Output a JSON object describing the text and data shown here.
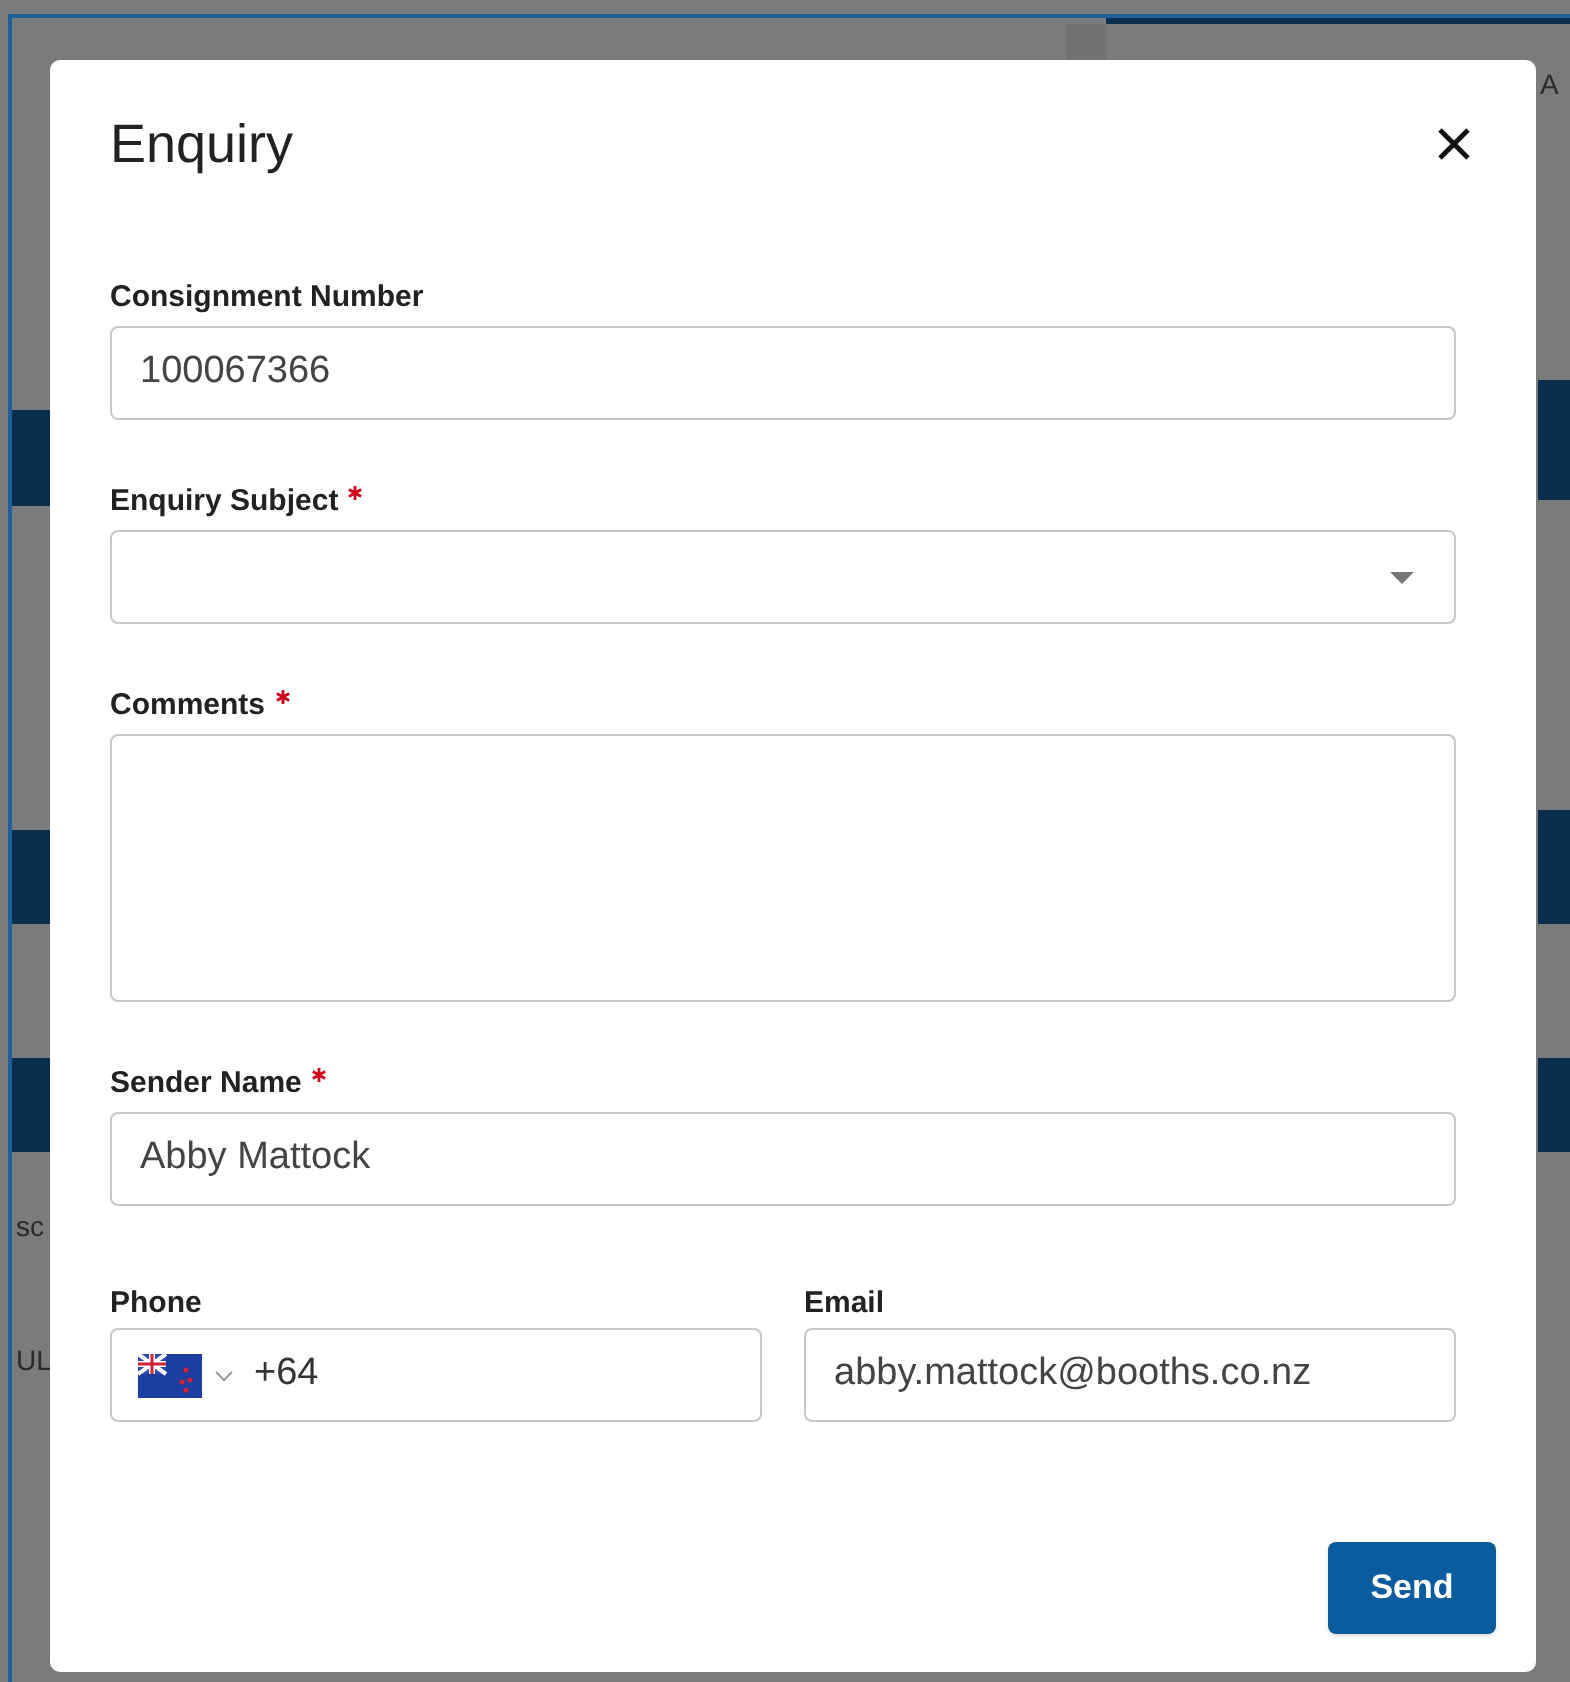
{
  "background": {
    "texts": [
      "A",
      "sc",
      "UL"
    ]
  },
  "dialog": {
    "title": "Enquiry",
    "fields": [
      {
        "kind": "text",
        "label": "Consignment Number",
        "required": false,
        "value": "100067366"
      },
      {
        "kind": "select",
        "label": "Enquiry Subject",
        "required": true
      },
      {
        "kind": "textarea",
        "label": "Comments",
        "required": true
      },
      {
        "kind": "text",
        "label": "Sender Name",
        "required": true,
        "value": "Abby Mattock"
      }
    ],
    "phone": {
      "label": "Phone",
      "required": false,
      "value": "+64"
    },
    "email": {
      "label": "Email",
      "required": false,
      "value": "abby.mattock@booths.co.nz"
    },
    "button": "Send"
  }
}
